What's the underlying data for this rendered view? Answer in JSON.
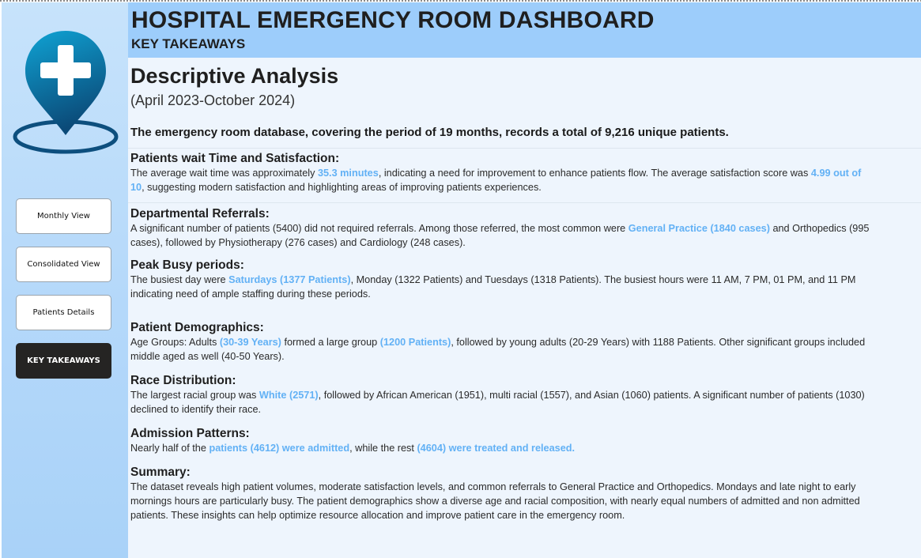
{
  "header": {
    "title": "HOSPITAL EMERGENCY ROOM DASHBOARD",
    "subtitle": "KEY TAKEAWAYS"
  },
  "sidebar": {
    "logo_icon": "hospital-location-pin-icon",
    "nav": [
      {
        "label": "Monthly View",
        "active": false
      },
      {
        "label": "Consolidated View",
        "active": false
      },
      {
        "label": "Patients Details",
        "active": false
      },
      {
        "label": "KEY TAKEAWAYS",
        "active": true
      }
    ]
  },
  "colors": {
    "header_bg": "#9dcdfb",
    "sidebar_bg": "#b4d8fa",
    "main_bg": "#eef5fd",
    "highlight": "#62b1f5",
    "active_button": "#252423",
    "logo_gradient": [
      "#0a8fc2",
      "#0c4f7a"
    ]
  },
  "main": {
    "heading": "Descriptive Analysis",
    "period": "(April 2023-October 2024)",
    "intro": "The emergency room database, covering the period of 19 months, records a total of 9,216 unique patients.",
    "sections": {
      "wait": {
        "title": "Patients wait Time and Satisfaction:",
        "l1_a": "The average wait time was approximately ",
        "l1_b": "35.3 minutes",
        "l1_c": ", indicating a need for improvement to enhance patients flow. The average satisfaction score was ",
        "l1_d": "4.99 out of",
        "l2_a": "10",
        "l2_b": ", suggesting modern satisfaction and highlighting areas of improving patients experiences."
      },
      "referrals": {
        "title": "Departmental Referrals:",
        "l1_a": "A significant number of patients (5400) did not required referrals. Among those referred, the most common were ",
        "l1_b": "General Practice (1840 cases)",
        "l1_c": " and Orthopedics (995",
        "l2": "cases), followed by Physiotherapy (276 cases) and Cardiology (248 cases)."
      },
      "peak": {
        "title": "Peak Busy periods:",
        "l1_a": "The busiest day were ",
        "l1_b": "Saturdays (1377 Patients)",
        "l1_c": ", Monday (1322 Patients) and Tuesdays (1318 Patients). The busiest hours were 11 AM, 7 PM, 01 PM, and 11 PM",
        "l2": "indicating need of ample staffing during these periods."
      },
      "demographics": {
        "title": "Patient Demographics:",
        "l1_a": "Age Groups: Adults ",
        "l1_b": "(30-39 Years)",
        "l1_c": " formed a large group ",
        "l1_d": "(1200 Patients)",
        "l1_e": ", followed by young adults (20-29 Years) with 1188 Patients. Other significant groups included",
        "l2": "middle aged as well (40-50 Years)."
      },
      "race": {
        "title": "Race Distribution:",
        "l1_a": "The largest racial group was ",
        "l1_b": "White (2571)",
        "l1_c": ", followed by African American (1951), multi racial (1557), and Asian (1060) patients. A significant number of patients (1030)",
        "l2": "declined to identify their race."
      },
      "admission": {
        "title": "Admission Patterns:",
        "l1_a": "Nearly half of the ",
        "l1_b": "patients (4612) were admitted",
        "l1_c": ", while the rest ",
        "l1_d": "(4604) were treated and released."
      },
      "summary": {
        "title": "Summary:",
        "l1": "The dataset reveals high patient volumes, moderate satisfaction levels, and common referrals to General Practice and Orthopedics. Mondays and late night to early",
        "l2": "mornings hours are particularly busy. The patient demographics show a diverse age and racial composition, with nearly equal numbers of admitted and non admitted",
        "l3": "patients. These insights can help optimize resource allocation and improve patient care in the emergency room."
      }
    }
  }
}
